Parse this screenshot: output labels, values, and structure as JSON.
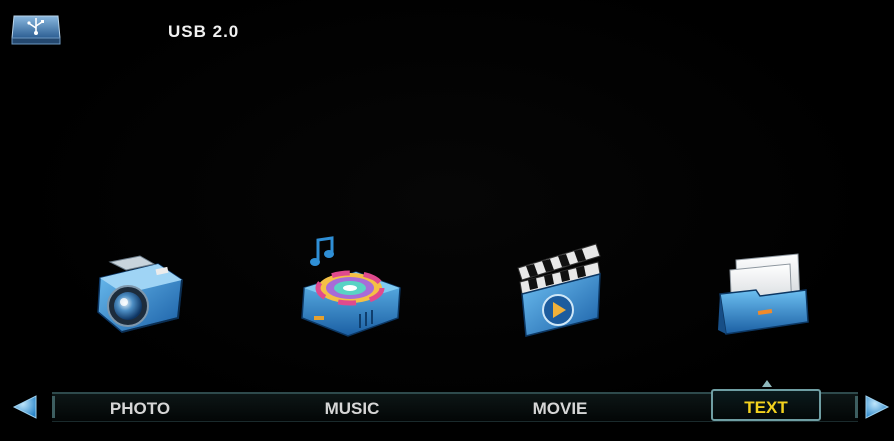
{
  "header": {
    "device_label": "USB 2.0",
    "device_icon": "usb-drive-icon"
  },
  "menu": {
    "items": [
      {
        "label": "PHOTO",
        "icon": "camera-icon",
        "selected": false
      },
      {
        "label": "MUSIC",
        "icon": "music-disc-icon",
        "selected": false
      },
      {
        "label": "MOVIE",
        "icon": "clapperboard-icon",
        "selected": false
      },
      {
        "label": "TEXT",
        "icon": "folder-document-icon",
        "selected": true
      }
    ],
    "nav_left_icon": "arrow-left-icon",
    "nav_right_icon": "arrow-right-icon"
  },
  "colors": {
    "background": "#000000",
    "selected_text": "#f3d21e",
    "label_text": "#d6d6d6",
    "icon_blue": "#2f8fd6"
  }
}
